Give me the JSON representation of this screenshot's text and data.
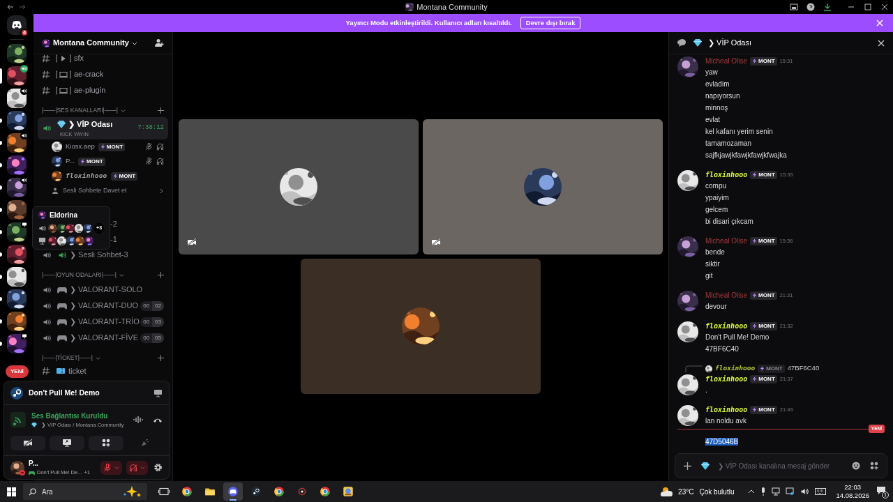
{
  "title_bar": {
    "title": "Montana Community"
  },
  "banner": {
    "message": "Yayıncı Modu etkinleştirildi. Kullanıcı adları kısaltıldı.",
    "button": "Devre dışı bırak"
  },
  "server_rail": {
    "home_badge": "4",
    "new_badge": "YENİ",
    "servers": [
      {
        "kind": "plain",
        "selected": false,
        "unread": false
      },
      {
        "kind": "speaking",
        "selected": true,
        "unread": false
      },
      {
        "kind": "voice",
        "selected": false,
        "unread": false
      },
      {
        "kind": "plain",
        "selected": false,
        "unread": true
      },
      {
        "kind": "voice",
        "selected": false,
        "unread": true
      },
      {
        "kind": "plain",
        "selected": false,
        "unread": true
      },
      {
        "kind": "voice",
        "selected": false,
        "unread": true
      },
      {
        "kind": "plain",
        "selected": false,
        "unread": true
      },
      {
        "kind": "screen",
        "selected": false,
        "unread": true
      },
      {
        "kind": "plain",
        "selected": false,
        "unread": true
      },
      {
        "kind": "plain",
        "selected": false,
        "unread": true
      },
      {
        "kind": "plain",
        "selected": false,
        "unread": true
      },
      {
        "kind": "plain",
        "selected": false,
        "unread": true
      },
      {
        "kind": "screen",
        "selected": false,
        "unread": true
      }
    ]
  },
  "sidebar": {
    "server_name": "Montana Community",
    "channels": [
      {
        "kind": "media",
        "name": "sfx"
      },
      {
        "kind": "laptop",
        "name": "ae-crack"
      },
      {
        "kind": "laptop",
        "name": "ae-plugin"
      },
      {
        "kind": "category",
        "name": "|——|SES KANALLARI|——|"
      },
      {
        "kind": "vip",
        "name": "❯ VİP Odası",
        "selected": true,
        "status": "KICK YAYIN",
        "timer": "7:38:12",
        "invite": "Sesli Sohbete Davet et",
        "members": [
          {
            "name": "Kiosx.aep",
            "tag": "MONT",
            "fancy": false,
            "muted": true,
            "deafened": true
          },
          {
            "name": "P...",
            "tag": "MONT",
            "fancy": false,
            "muted": true,
            "deafened": true
          },
          {
            "name": "floxinhooo",
            "tag": "MONT",
            "fancy": true,
            "muted": false,
            "deafened": false
          }
        ]
      },
      {
        "kind": "partial",
        "name": "-2"
      },
      {
        "kind": "partial",
        "name": "-1"
      },
      {
        "kind": "voice",
        "name": "❯ Sesli Sohbet-3",
        "selected": false
      },
      {
        "kind": "category",
        "name": "|——|OYUN ODALARI|——|"
      },
      {
        "kind": "game",
        "name": "❯ VALORANT-SOLO",
        "selected": false
      },
      {
        "kind": "game",
        "name": "❯ VALORANT-DUO",
        "selected": false,
        "count": "00",
        "limit": "02"
      },
      {
        "kind": "game",
        "name": "❯ VALORANT-TRİO",
        "selected": false,
        "count": "00",
        "limit": "03"
      },
      {
        "kind": "game",
        "name": "❯ VALORANT-FİVE",
        "selected": false,
        "count": "00",
        "limit": "05"
      },
      {
        "kind": "category",
        "name": "|——|TİCKET|——|"
      },
      {
        "kind": "ticket",
        "name": "ticket"
      }
    ]
  },
  "tooltip": {
    "title": "Eldorina",
    "extra": "+3"
  },
  "panel": {
    "activity": "Don't Pull Me! Demo",
    "connection_status": "Ses Bağlantısı Kuruldu",
    "connection_channel": "❯ VİP Odası / Montana Community",
    "buttons": [
      {
        "kind": "camera",
        "disabled": false
      },
      {
        "kind": "screen",
        "disabled": false
      },
      {
        "kind": "activities",
        "disabled": false
      },
      {
        "kind": "soundboard",
        "disabled": true
      }
    ],
    "user": {
      "name": "P...",
      "activity": "Don't Pull Me! De...",
      "extra": "+1",
      "muted": true,
      "deafened": true
    }
  },
  "videos": [
    {
      "camera_off": true
    },
    {
      "camera_off": true
    },
    {
      "camera_off": false
    }
  ],
  "chat": {
    "title": "❯ VİP Odası",
    "placeholder": "❯ VİP Odası kanalına mesaj gönder",
    "items": [
      {
        "kind": "message",
        "author": "Micheal Olise",
        "color": "#a8383f",
        "fancy": false,
        "tag": "MONT",
        "time": "15:31",
        "lines": [
          "yaw",
          "evladim",
          "napıyorsun",
          "minnoş",
          "evlat",
          "kel kafanı yerim senin",
          "tamamozaman",
          "sajfkjawjkfawjkfawjkfwajka"
        ]
      },
      {
        "kind": "message",
        "author": "floxinhooo",
        "color": "#d6f53a",
        "fancy": true,
        "tag": "MONT",
        "time": "15:35",
        "lines": [
          "compu",
          "ypaiyim",
          "gelcem",
          "bi disari çıkcam"
        ]
      },
      {
        "kind": "message",
        "author": "Micheal Olise",
        "color": "#a8383f",
        "fancy": false,
        "tag": "MONT",
        "time": "15:36",
        "lines": [
          "bende",
          "siktir",
          "git"
        ]
      },
      {
        "kind": "message",
        "author": "Micheal Olise",
        "color": "#a8383f",
        "fancy": false,
        "tag": "MONT",
        "time": "21:31",
        "lines": [
          "devour"
        ]
      },
      {
        "kind": "message",
        "author": "floxinhooo",
        "color": "#d6f53a",
        "fancy": true,
        "tag": "MONT",
        "time": "21:32",
        "lines": [
          "Don't Pull Me! Demo",
          "47BF6C40"
        ]
      },
      {
        "kind": "message",
        "author": "floxinhooo",
        "color": "#d6f53a",
        "fancy": true,
        "tag": "MONT",
        "time": "21:37",
        "reply": {
          "author": "floxinhooo",
          "tag": "MONT",
          "text": "47BF6C40"
        },
        "lines": [
          "."
        ]
      },
      {
        "kind": "message",
        "author": "floxinhooo",
        "color": "#d6f53a",
        "fancy": true,
        "tag": "MONT",
        "time": "21:49",
        "lines": [
          "lan noldu avk"
        ]
      },
      {
        "kind": "divider",
        "label": "YENİ"
      },
      {
        "kind": "continuation",
        "text": "47D5046B",
        "highlighted": true
      }
    ]
  },
  "taskbar": {
    "search_placeholder": "Ara",
    "apps": [
      {
        "kind": "taskview",
        "active": false
      },
      {
        "kind": "browser",
        "active": false
      },
      {
        "kind": "folder",
        "active": false
      },
      {
        "kind": "chat",
        "active": true
      },
      {
        "kind": "steam",
        "active": false
      },
      {
        "kind": "browser",
        "active": false
      },
      {
        "kind": "disc",
        "active": false
      },
      {
        "kind": "browser",
        "active": false
      },
      {
        "kind": "game",
        "active": false
      }
    ],
    "weather_temp": "23°C",
    "weather_text": "Çok bulutlu",
    "time": "22:03",
    "date": "14.08.2026",
    "notifications": "1"
  }
}
